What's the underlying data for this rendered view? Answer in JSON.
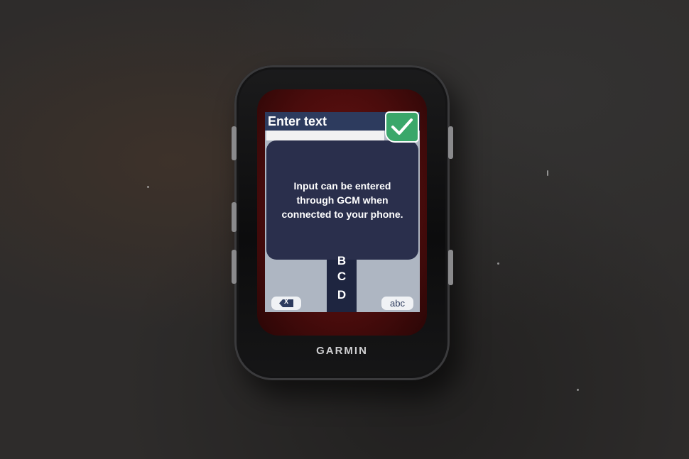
{
  "screen": {
    "title": "Enter text",
    "text_value": "",
    "dialog_message_lines": [
      "Input can be entered",
      "through GCM when",
      "connected to your phone."
    ],
    "picker_letters": [
      "B",
      "C",
      "D"
    ],
    "backspace_label": "X",
    "mode_key_label": "abc",
    "confirm_icon": "checkmark-icon"
  },
  "device": {
    "brand": "GARMIN"
  },
  "colors": {
    "title_bar": "#2d3b5e",
    "dialog": "#2a2f4c",
    "confirm": "#3aa76a",
    "keyboard_bg": "#aeb6c2"
  }
}
